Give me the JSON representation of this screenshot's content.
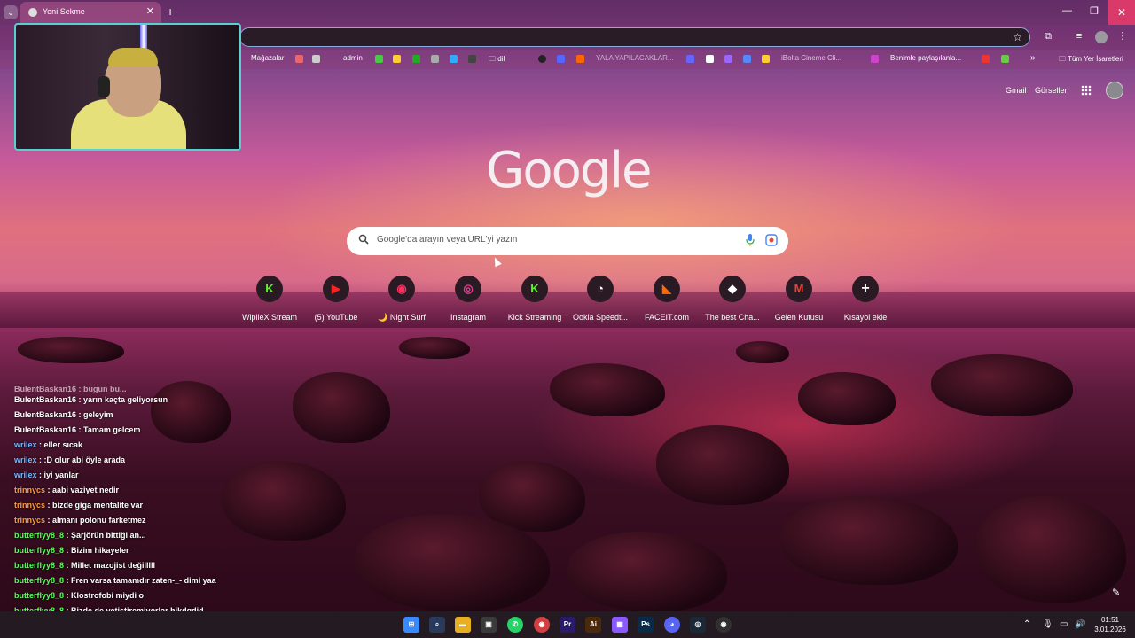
{
  "browser": {
    "tab_title": "Yeni Sekme",
    "new_tab": "+",
    "tab_close": "✕",
    "tab_menu": "⌄",
    "win_min": "—",
    "win_max": "❐",
    "win_close": "✕",
    "star": "☆"
  },
  "bookmarks": {
    "items": [
      {
        "label": "Mağazalar"
      },
      {
        "label": "admin"
      },
      {
        "label": "dil"
      },
      {
        "label": "YALA YAPILACAKLAR..."
      },
      {
        "label": "iBolta Cineme Cli..."
      },
      {
        "label": "Benimle paylaşılanla..."
      }
    ],
    "more": "»",
    "all_bookmarks": "Tüm Yer İşaretleri"
  },
  "google": {
    "gmail": "Gmail",
    "images": "Görseller",
    "logo": "Google",
    "search_placeholder": "Google'da arayın veya URL'yi yazın"
  },
  "shortcuts": [
    {
      "label": "WiplleX Stream",
      "glyph": "K",
      "color": "#53fc18"
    },
    {
      "label": "(5) YouTube",
      "glyph": "▶",
      "color": "#ff2020"
    },
    {
      "label": "🌙 Night Surf",
      "glyph": "◉",
      "color": "#ff3060"
    },
    {
      "label": "Instagram",
      "glyph": "◎",
      "color": "#e04090"
    },
    {
      "label": "Kick Streaming",
      "glyph": "K",
      "color": "#53fc18"
    },
    {
      "label": "Ookla Speedt...",
      "glyph": "◔",
      "color": "#ffffff"
    },
    {
      "label": "FACEIT.com",
      "glyph": "◣",
      "color": "#ff6a00"
    },
    {
      "label": "The best Cha...",
      "glyph": "◆",
      "color": "#ffffff"
    },
    {
      "label": "Gelen Kutusu",
      "glyph": "M",
      "color": "#ea4335"
    },
    {
      "label": "Kısayol ekle",
      "glyph": "+",
      "color": "#ffffff"
    }
  ],
  "chat": {
    "partial": "BulentBaskan16 : bugun bu...",
    "messages": [
      {
        "user": "BulentBaskan16",
        "text": " : yarın kaçta geliyorsun",
        "color": "#ffffff"
      },
      {
        "user": "BulentBaskan16",
        "text": " : geleyim",
        "color": "#ffffff"
      },
      {
        "user": "BulentBaskan16",
        "text": " : Tamam gelcem",
        "color": "#ffffff"
      },
      {
        "user": "wrilex",
        "text": " : eller sıcak",
        "color": "#7ab8ff"
      },
      {
        "user": "wrilex",
        "text": " : :D olur abi öyle arada",
        "color": "#7ab8ff"
      },
      {
        "user": "wrilex",
        "text": " : iyi yanlar",
        "color": "#7ab8ff"
      },
      {
        "user": "trinnycs",
        "text": " : aabi vaziyet nedir",
        "color": "#ff9a3c"
      },
      {
        "user": "trinnycs",
        "text": " : bizde giga mentalite var",
        "color": "#ff9a3c"
      },
      {
        "user": "trinnycs",
        "text": " : almanı polonu farketmez",
        "color": "#ff9a3c"
      },
      {
        "user": "butterflyy8_8",
        "text": " : Şarjörün bittiği an...",
        "color": "#5cff5c"
      },
      {
        "user": "butterflyy8_8",
        "text": " : Bizim hikayeler",
        "color": "#5cff5c"
      },
      {
        "user": "butterflyy8_8",
        "text": " : Millet mazojist değilllll",
        "color": "#5cff5c"
      },
      {
        "user": "butterflyy8_8",
        "text": " : Fren varsa tamamdır zaten-_- dimi yaa",
        "color": "#5cff5c"
      },
      {
        "user": "butterflyy8_8",
        "text": " : Klostrofobi miydi o",
        "color": "#5cff5c"
      },
      {
        "user": "butterflyy8_8",
        "text": " : Bizde de yetiştiremiyorlar hjkdgdjd",
        "color": "#5cff5c"
      }
    ]
  },
  "taskbar": {
    "apps": [
      {
        "name": "windows-start",
        "glyph": "⊞",
        "color": "#3a8aff"
      },
      {
        "name": "search",
        "glyph": "⌕",
        "color": "#5a9aff"
      },
      {
        "name": "file-explorer",
        "glyph": "▬",
        "color": "#e8b020"
      },
      {
        "name": "store",
        "glyph": "▣",
        "color": "#3a3a3a"
      },
      {
        "name": "whatsapp",
        "glyph": "✆",
        "color": "#25d366"
      },
      {
        "name": "chrome",
        "glyph": "◉",
        "color": "#d04040"
      },
      {
        "name": "premiere",
        "glyph": "Pr",
        "color": "#2a1a6a"
      },
      {
        "name": "illustrator",
        "glyph": "Ai",
        "color": "#4a2a0a"
      },
      {
        "name": "stream-app",
        "glyph": "▦",
        "color": "#8a5aff"
      },
      {
        "name": "photoshop",
        "glyph": "Ps",
        "color": "#0a2a4a"
      },
      {
        "name": "discord",
        "glyph": "◕",
        "color": "#5865f2"
      },
      {
        "name": "steam",
        "glyph": "◎",
        "color": "#1b2838"
      },
      {
        "name": "obs",
        "glyph": "◉",
        "color": "#303030"
      }
    ],
    "tray_arrow": "⌃",
    "time": "01:51",
    "date": "3.01.2026"
  }
}
